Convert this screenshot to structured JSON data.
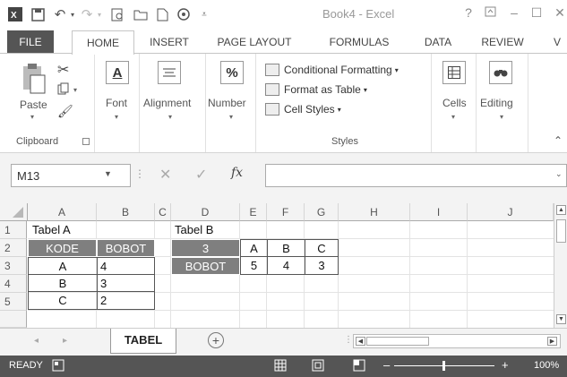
{
  "title_bar": {
    "document_title": "Book4 - Excel",
    "help_label": "?",
    "icons": [
      "excel-logo-icon",
      "save-icon",
      "undo-icon",
      "redo-icon",
      "print-preview-icon",
      "open-icon",
      "new-icon",
      "touch-mode-icon",
      "customize-qat-icon"
    ]
  },
  "tabs": [
    "FILE",
    "HOME",
    "INSERT",
    "PAGE LAYOUT",
    "FORMULAS",
    "DATA",
    "REVIEW",
    "V"
  ],
  "ribbon": {
    "clipboard": {
      "paste": "Paste",
      "group": "Clipboard"
    },
    "font": {
      "label": "Font"
    },
    "alignment": {
      "label": "Alignment"
    },
    "number": {
      "label": "Number",
      "icon_text": "%"
    },
    "font_icon_text": "A",
    "styles": {
      "conditional": "Conditional Formatting",
      "format_table": "Format as Table",
      "cell_styles": "Cell Styles",
      "group": "Styles"
    },
    "cells": {
      "label": "Cells"
    },
    "editing": {
      "label": "Editing"
    }
  },
  "formula_bar": {
    "name_box": "M13",
    "fx": "fx",
    "value": ""
  },
  "grid": {
    "columns": [
      "A",
      "B",
      "C",
      "D",
      "E",
      "F",
      "G",
      "H",
      "I",
      "J"
    ],
    "rows": [
      "1",
      "2",
      "3",
      "4",
      "5"
    ],
    "cells": {
      "A1": "Tabel A",
      "A2": "KODE",
      "B2": "BOBOT",
      "A3": "A",
      "B3": "4",
      "A4": "B",
      "B4": "3",
      "A5": "C",
      "B5": "2",
      "D1": "Tabel B",
      "D2": "3",
      "E2": "A",
      "F2": "B",
      "G2": "C",
      "D3": "BOBOT",
      "E3": "5",
      "F3": "4",
      "G3": "3"
    }
  },
  "sheets": {
    "active": "TABEL",
    "add": "+"
  },
  "status_bar": {
    "mode": "READY",
    "zoom": "100%"
  },
  "colors": {
    "accent_tab": "#555555",
    "header_fill": "#7f7f7f",
    "status_bg": "#555555"
  }
}
